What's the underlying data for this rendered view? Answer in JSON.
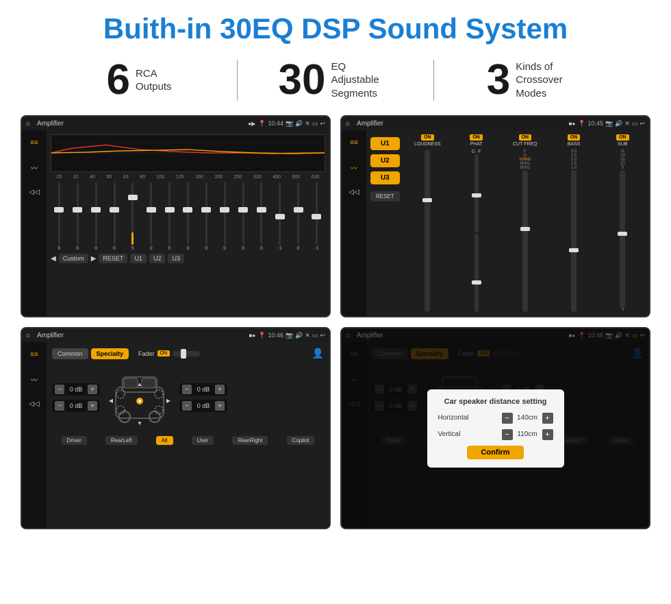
{
  "header": {
    "title": "Buith-in 30EQ DSP Sound System"
  },
  "stats": [
    {
      "number": "6",
      "text": "RCA\nOutputs"
    },
    {
      "number": "30",
      "text": "EQ Adjustable\nSegments"
    },
    {
      "number": "3",
      "text": "Kinds of\nCrossover Modes"
    }
  ],
  "screens": [
    {
      "id": "eq-screen",
      "title": "Amplifier",
      "time": "10:44",
      "type": "equalizer"
    },
    {
      "id": "crossover-screen",
      "title": "Amplifier",
      "time": "10:45",
      "type": "crossover"
    },
    {
      "id": "fader-screen",
      "title": "Amplifier",
      "time": "10:46",
      "type": "fader"
    },
    {
      "id": "dialog-screen",
      "title": "Amplifier",
      "time": "10:46",
      "type": "dialog"
    }
  ],
  "eq": {
    "bands": [
      "25",
      "32",
      "40",
      "50",
      "63",
      "80",
      "100",
      "125",
      "160",
      "200",
      "250",
      "320",
      "400",
      "500",
      "630"
    ],
    "values": [
      "0",
      "0",
      "0",
      "0",
      "5",
      "0",
      "0",
      "0",
      "0",
      "0",
      "0",
      "0",
      "-1",
      "0",
      "-1"
    ],
    "preset": "Custom",
    "buttons": [
      "RESET",
      "U1",
      "U2",
      "U3"
    ]
  },
  "crossover": {
    "presets": [
      "U1",
      "U2",
      "U3"
    ],
    "channels": [
      {
        "label": "LOUDNESS",
        "on": true
      },
      {
        "label": "PHAT",
        "on": true
      },
      {
        "label": "CUT FREQ",
        "on": true
      },
      {
        "label": "BASS",
        "on": true
      },
      {
        "label": "SUB",
        "on": true
      }
    ],
    "reset_label": "RESET"
  },
  "fader": {
    "tabs": [
      "Common",
      "Specialty"
    ],
    "active_tab": "Specialty",
    "fader_label": "Fader",
    "on_label": "ON",
    "db_values": [
      "0 dB",
      "0 dB",
      "0 dB",
      "0 dB"
    ],
    "footer_buttons": [
      "Driver",
      "RearLeft",
      "All",
      "User",
      "RearRight",
      "Copilot"
    ]
  },
  "dialog": {
    "title": "Car speaker distance setting",
    "rows": [
      {
        "label": "Horizontal",
        "value": "140cm"
      },
      {
        "label": "Vertical",
        "value": "110cm"
      }
    ],
    "confirm_label": "Confirm"
  }
}
